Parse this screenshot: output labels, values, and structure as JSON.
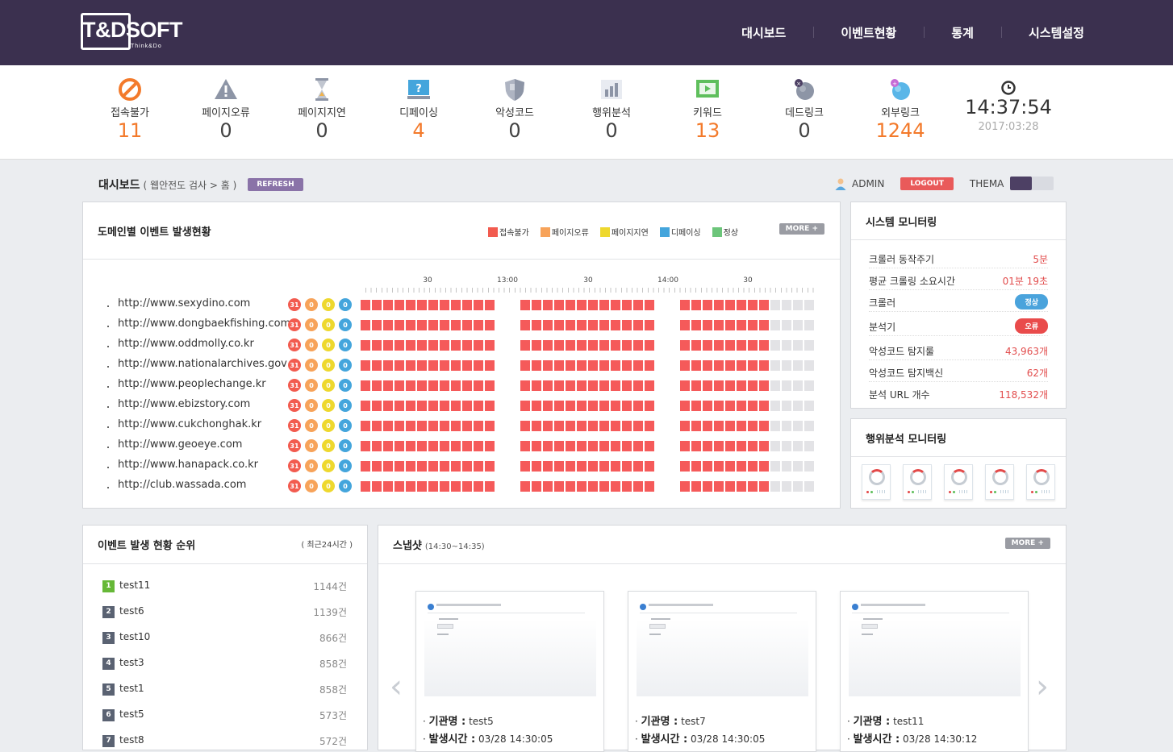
{
  "brand": {
    "name": "T&DSOFT",
    "tagline": "Think&Do"
  },
  "nav": [
    "대시보드",
    "이벤트현황",
    "통계",
    "시스템설정"
  ],
  "stats": [
    {
      "icon": "no-access-icon",
      "label": "접속불가",
      "value": "11",
      "highlight": true
    },
    {
      "icon": "warning-icon",
      "label": "페이지오류",
      "value": "0",
      "highlight": false
    },
    {
      "icon": "hourglass-icon",
      "label": "페이지지연",
      "value": "0",
      "highlight": false
    },
    {
      "icon": "defacing-monitor-icon",
      "label": "디페이싱",
      "value": "4",
      "highlight": true
    },
    {
      "icon": "shield-icon",
      "label": "악성코드",
      "value": "0",
      "highlight": false
    },
    {
      "icon": "bar-chart-icon",
      "label": "행위분석",
      "value": "0",
      "highlight": false
    },
    {
      "icon": "keyword-screen-icon",
      "label": "키워드",
      "value": "13",
      "highlight": true
    },
    {
      "icon": "dead-link-globe-icon",
      "label": "데드링크",
      "value": "0",
      "highlight": false
    },
    {
      "icon": "external-link-globe-icon",
      "label": "외부링크",
      "value": "1244",
      "highlight": true
    }
  ],
  "clock": {
    "time": "14:37:54",
    "date": "2017:03:28"
  },
  "breadcrumb": {
    "title": "대시보드",
    "path": "( 웹안전도 검사 > 홈 )",
    "refresh": "REFRESH"
  },
  "user": {
    "name": "ADMIN",
    "logout": "LOGOUT",
    "theme": "THEMA"
  },
  "domain_panel": {
    "title": "도메인별 이벤트 발생현황",
    "more": "MORE +",
    "legend": [
      {
        "label": "접속불가",
        "color": "#f25b4f"
      },
      {
        "label": "페이지오류",
        "color": "#f7a35a"
      },
      {
        "label": "페이지지연",
        "color": "#eed82e"
      },
      {
        "label": "디페이싱",
        "color": "#44a5dc"
      },
      {
        "label": "정상",
        "color": "#6cc57a"
      }
    ],
    "time_labels": [
      "30",
      "13:00",
      "30",
      "14:00",
      "30"
    ],
    "colors": {
      "event": "#f55a5a",
      "empty": "#e3e3e6"
    },
    "filled_slots_in_last_block": 8,
    "rows": [
      {
        "url": "http://www.sexydino.com",
        "counts": [
          "31",
          "0",
          "0",
          "0"
        ]
      },
      {
        "url": "http://www.dongbaekfishing.com",
        "counts": [
          "31",
          "0",
          "0",
          "0"
        ]
      },
      {
        "url": "http://www.oddmolly.co.kr",
        "counts": [
          "31",
          "0",
          "0",
          "0"
        ]
      },
      {
        "url": "http://www.nationalarchives.gov",
        "counts": [
          "31",
          "0",
          "0",
          "0"
        ]
      },
      {
        "url": "http://www.peoplechange.kr",
        "counts": [
          "31",
          "0",
          "0",
          "0"
        ]
      },
      {
        "url": "http://www.ebizstory.com",
        "counts": [
          "31",
          "0",
          "0",
          "0"
        ]
      },
      {
        "url": "http://www.cukchonghak.kr",
        "counts": [
          "31",
          "0",
          "0",
          "0"
        ]
      },
      {
        "url": "http://www.geoeye.com",
        "counts": [
          "31",
          "0",
          "0",
          "0"
        ]
      },
      {
        "url": "http://www.hanapack.co.kr",
        "counts": [
          "31",
          "0",
          "0",
          "0"
        ]
      },
      {
        "url": "http://club.wassada.com",
        "counts": [
          "31",
          "0",
          "0",
          "0"
        ]
      }
    ]
  },
  "system_panel": {
    "title": "시스템 모니터링",
    "rows": [
      {
        "label": "크롤러 동작주기",
        "value": "5분"
      },
      {
        "label": "평균 크롤링 소요시간",
        "value": "01분 19초"
      },
      {
        "label": "크롤러",
        "pill": "정상",
        "pill_color": "#4aa3dc"
      },
      {
        "label": "분석기",
        "pill": "오류",
        "pill_color": "#e94b4b"
      },
      {
        "label": "악성코드 탐지룰",
        "value": "43,963개"
      },
      {
        "label": "악성코드 탐지백신",
        "value": "62개"
      },
      {
        "label": "분석 URL 개수",
        "value": "118,532개"
      }
    ]
  },
  "behavior_panel": {
    "title": "행위분석 모니터링",
    "monitors": 5
  },
  "rank_panel": {
    "title": "이벤트 발생 현황 순위",
    "note": "( 최근24시간 )",
    "rows": [
      {
        "rank": "1",
        "name": "test11",
        "count": "1144건"
      },
      {
        "rank": "2",
        "name": "test6",
        "count": "1139건"
      },
      {
        "rank": "3",
        "name": "test10",
        "count": "866건"
      },
      {
        "rank": "4",
        "name": "test3",
        "count": "858건"
      },
      {
        "rank": "5",
        "name": "test1",
        "count": "858건"
      },
      {
        "rank": "6",
        "name": "test5",
        "count": "573건"
      },
      {
        "rank": "7",
        "name": "test8",
        "count": "572건"
      }
    ]
  },
  "snapshot_panel": {
    "title": "스냅샷",
    "range": "(14:30~14:35)",
    "more": "MORE +",
    "cards": [
      {
        "org_label": "기관명 :",
        "org": "test5",
        "time_label": "발생시간 :",
        "time": "03/28 14:30:05"
      },
      {
        "org_label": "기관명 :",
        "org": "test7",
        "time_label": "발생시간 :",
        "time": "03/28 14:30:05"
      },
      {
        "org_label": "기관명 :",
        "org": "test11",
        "time_label": "발생시간 :",
        "time": "03/28 14:30:12"
      }
    ]
  }
}
